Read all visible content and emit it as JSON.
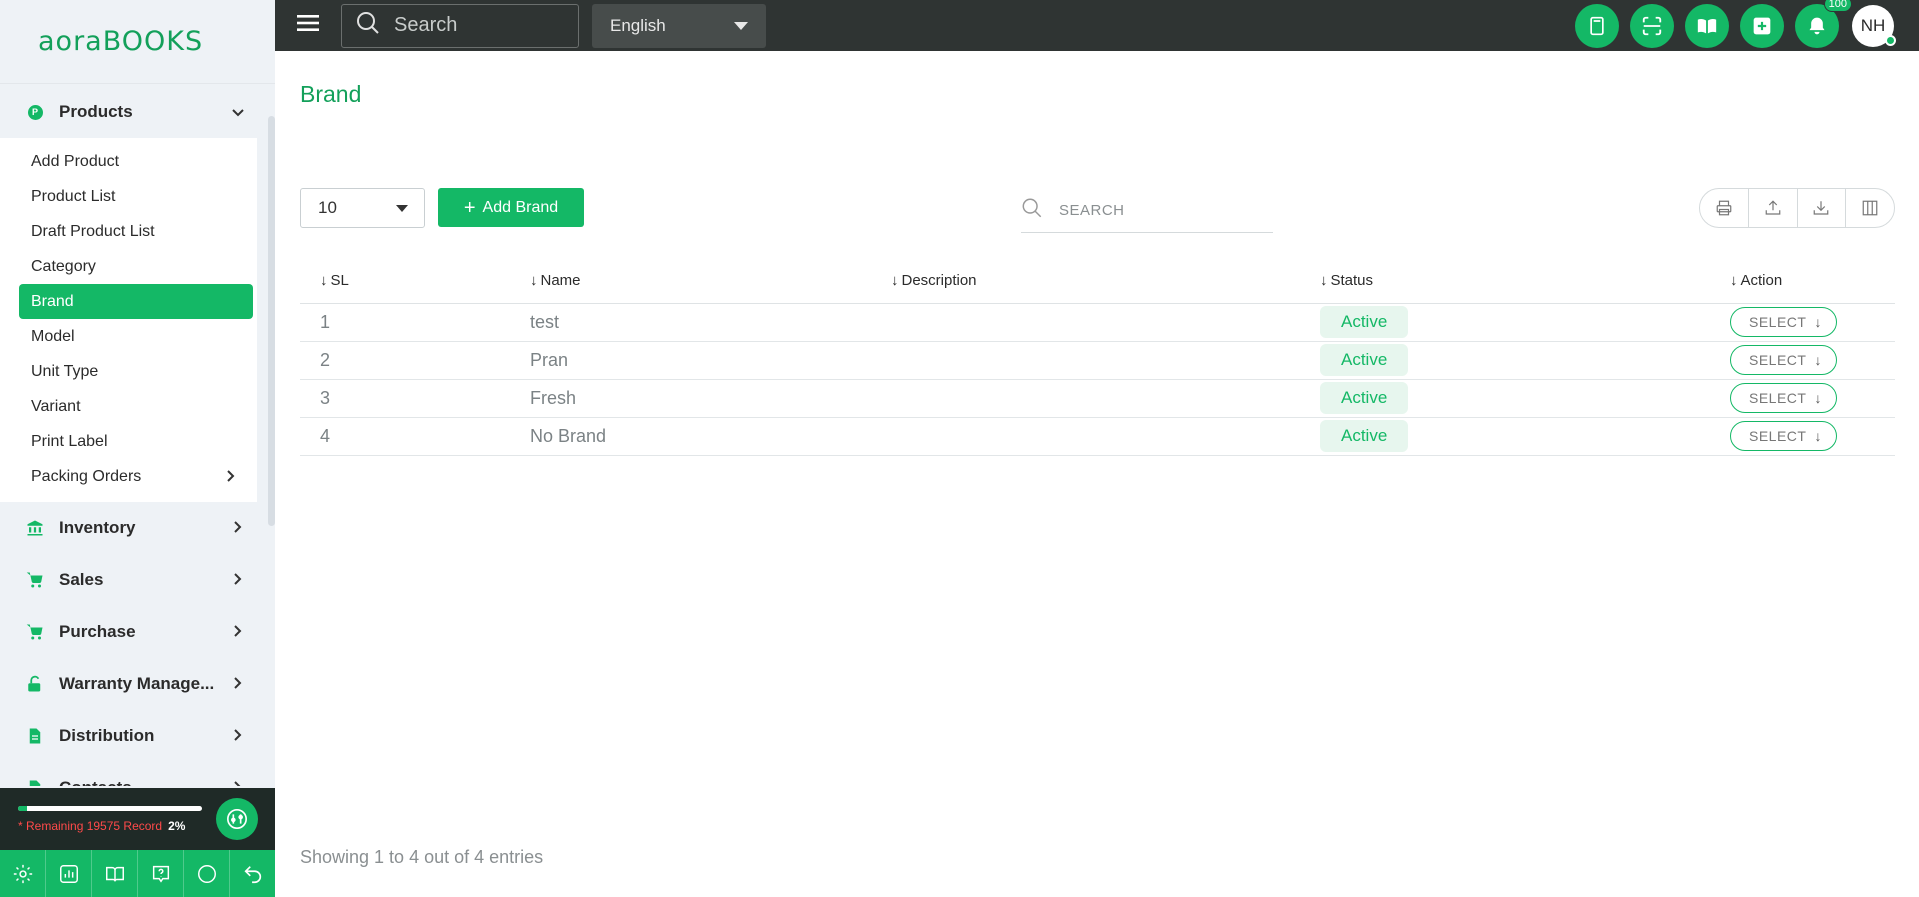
{
  "app": {
    "logo_text_left": "aora",
    "logo_text_right": "BOOKS"
  },
  "topbar": {
    "search_placeholder": "Search",
    "language": "English",
    "notification_count": "100",
    "user_initials": "NH",
    "icons": [
      "calculator-icon",
      "scan-icon",
      "book-icon",
      "add-icon",
      "bell-icon"
    ]
  },
  "sidebar": {
    "products_label": "Products",
    "products_badge": "P",
    "product_items": [
      {
        "label": "Add Product"
      },
      {
        "label": "Product List"
      },
      {
        "label": "Draft Product List"
      },
      {
        "label": "Category"
      },
      {
        "label": "Brand",
        "active": true
      },
      {
        "label": "Model"
      },
      {
        "label": "Unit Type"
      },
      {
        "label": "Variant"
      },
      {
        "label": "Print Label"
      },
      {
        "label": "Packing Orders"
      }
    ],
    "groups": [
      {
        "label": "Inventory",
        "icon": "bank-icon"
      },
      {
        "label": "Sales",
        "icon": "cart-icon"
      },
      {
        "label": "Purchase",
        "icon": "cart-icon"
      },
      {
        "label": "Warranty Manage...",
        "icon": "unlock-icon"
      },
      {
        "label": "Distribution",
        "icon": "document-icon"
      },
      {
        "label": "Contacts",
        "icon": "document-icon"
      }
    ],
    "usage": {
      "remaining_text": "* Remaining 19575 Record",
      "percent_text": "2%",
      "percent_value": 0.02
    },
    "toolbar_icons": [
      "settings-icon",
      "chart-icon",
      "book-open-icon",
      "help-icon",
      "chat-icon",
      "logout-icon"
    ]
  },
  "main": {
    "title": "Brand",
    "per_page": "10",
    "add_button": "Add Brand",
    "search_placeholder": "SEARCH",
    "columns": [
      "SL",
      "Name",
      "Description",
      "Status",
      "Action"
    ],
    "rows": [
      {
        "sl": "1",
        "name": "test",
        "description": "",
        "status": "Active",
        "action": "SELECT"
      },
      {
        "sl": "2",
        "name": "Pran",
        "description": "",
        "status": "Active",
        "action": "SELECT"
      },
      {
        "sl": "3",
        "name": "Fresh",
        "description": "",
        "status": "Active",
        "action": "SELECT"
      },
      {
        "sl": "4",
        "name": "No Brand",
        "description": "",
        "status": "Active",
        "action": "SELECT"
      }
    ],
    "footer": "Showing 1 to 4 out of 4 entries"
  },
  "colors": {
    "accent": "#14b866",
    "topbar": "#2f3433",
    "sidebar": "#eef2f6"
  }
}
